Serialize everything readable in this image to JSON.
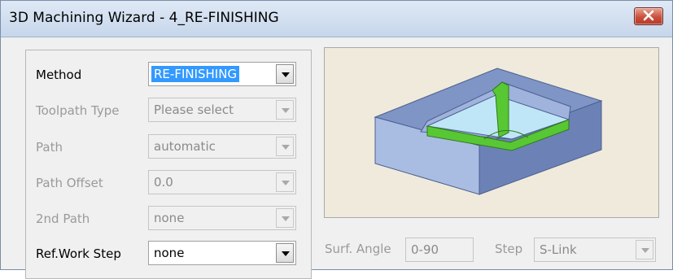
{
  "window": {
    "title": "3D Machining Wizard - 4_RE-FINISHING"
  },
  "form": {
    "method": {
      "label": "Method",
      "value": "RE-FINISHING"
    },
    "toolpath_type": {
      "label": "Toolpath Type",
      "value": "Please select"
    },
    "path": {
      "label": "Path",
      "value": "automatic"
    },
    "path_offset": {
      "label": "Path Offset",
      "value": "0.0"
    },
    "second_path": {
      "label": "2nd Path",
      "value": "none"
    },
    "ref_work_step": {
      "label": "Ref.Work Step",
      "value": "none"
    }
  },
  "surf_angle": {
    "label": "Surf. Angle",
    "value": "0-90"
  },
  "step": {
    "label": "Step",
    "value": "S-Link"
  },
  "colors": {
    "selection": "#3399ff",
    "close_button": "#c9503c",
    "preview_background": "#efeadb",
    "part_top": "#7f95c6",
    "part_front": "#9fb3dd",
    "pocket_floor": "#bfe6f6",
    "finishing_highlight": "#58c734"
  }
}
